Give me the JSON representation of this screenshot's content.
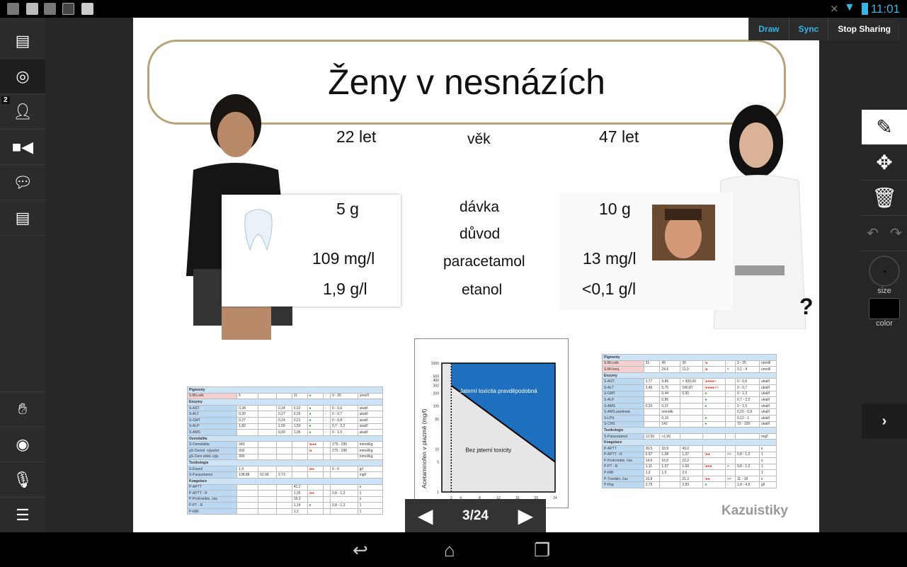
{
  "status_bar": {
    "time": "11:01",
    "icons": [
      "app-icon",
      "mail-icon",
      "image-icon",
      "gallery-icon",
      "store-icon",
      "bluetooth-off-icon",
      "wifi-icon",
      "battery-icon"
    ]
  },
  "top_buttons": {
    "draw": "Draw",
    "sync": "Sync",
    "stop_sharing": "Stop Sharing",
    "accent": "#34b5e5"
  },
  "left_sidebar": {
    "participants_badge": "2",
    "items": [
      "layout",
      "broadcast",
      "participants",
      "video",
      "chat",
      "notes",
      "raise-hand",
      "webcam",
      "microphone",
      "menu"
    ]
  },
  "right_toolbar": {
    "size_label": "size",
    "color_label": "color",
    "current_color": "#000000"
  },
  "slide": {
    "title": "Ženy v nesnázích",
    "left_age": "22 let",
    "age_label": "věk",
    "right_age": "47 let",
    "labels": [
      "dávka",
      "důvod",
      "paracetamol",
      "etanol"
    ],
    "left_values": [
      "5 g",
      "109 mg/l",
      "1,9 g/l"
    ],
    "right_values": [
      "10 g",
      "13 mg/l",
      "<0,1 g/l"
    ],
    "question": "?",
    "footer": "Kazuistiky",
    "left_table": [
      [
        "Pigmenty"
      ],
      [
        "S-Bil.celk",
        "5",
        "",
        "",
        "11",
        "●",
        "-",
        "3 - 25",
        "umol/l"
      ],
      [
        "Enzymy"
      ],
      [
        "S-AST",
        "0,38",
        "",
        "0,34",
        "0,32",
        "●",
        "-",
        "0 - 0,6",
        "ukat/l"
      ],
      [
        "S-ALT",
        "0,30",
        "",
        "0,27",
        "0,26",
        "●",
        "-",
        "0 - 0,7",
        "ukat/l"
      ],
      [
        "S-GMT",
        "0,27",
        "",
        "0,24",
        "0,21",
        "●",
        "-",
        "0 - 0,8",
        "ukat/l"
      ],
      [
        "S-ALP",
        "1,82",
        "",
        "1,56",
        "1,50",
        "●",
        "-",
        "0,7 - 2,2",
        "ukat/l"
      ],
      [
        "S-AMS",
        "",
        "",
        "0,99",
        "1,06",
        "●",
        "-",
        "0 - 1,5",
        "ukat/l"
      ],
      [
        "Osmolalita"
      ],
      [
        "S-Osmolalita",
        "343",
        "",
        "",
        "",
        "|●●●",
        "",
        "275 - 295",
        "mmol/kg"
      ],
      [
        "gS-Osmol. výpočet",
        "302",
        "",
        "",
        "",
        "|●",
        "",
        "275 - 295",
        "mmol/kg"
      ],
      [
        "gS-Osm.elekt.-výp.",
        "300",
        "",
        "",
        "",
        "",
        "",
        "",
        "mmol/kg"
      ],
      [
        "Toxikologie"
      ],
      [
        "S-Etanol",
        "1,9",
        "",
        "",
        "",
        "|●●",
        "",
        "0 - 0",
        "g/l"
      ],
      [
        "S-Paracetamol",
        "108,88",
        "52,68",
        "2,73",
        "",
        "",
        "",
        "",
        "mg/l"
      ],
      [
        "Koagulace"
      ],
      [
        "P-APTT",
        "",
        "",
        "",
        "41,2",
        "",
        "",
        "",
        "s"
      ],
      [
        "P-APTT - R",
        "",
        "",
        "",
        "1,35",
        "|●●",
        "",
        "0,8 - 1,2",
        "1"
      ],
      [
        "P-Protrombin. čas",
        "",
        "",
        "",
        "15,0",
        "",
        "",
        "",
        "s"
      ],
      [
        "P-PT - R",
        "",
        "",
        "",
        "1,14",
        "●",
        "",
        "0,8 - 1,2",
        "1"
      ],
      [
        "P-INR",
        "",
        "",
        "",
        "1,2",
        "",
        "",
        "",
        "1"
      ]
    ],
    "right_table": [
      [
        "Pigmenty"
      ],
      [
        "S-Bil.celk",
        "31",
        "49",
        "30",
        "|●",
        "-",
        "3 - 25",
        "umol/l"
      ],
      [
        "S-Bil.konj.",
        "",
        "24,6",
        "11,0",
        "|●",
        "<",
        "0,1 - 4",
        "umol/l"
      ],
      [
        "Enzymy"
      ],
      [
        "S-AST",
        "3,77",
        "9,86",
        "> 300,00",
        "|●●●●>",
        "",
        "0 - 0,6",
        "ukat/l"
      ],
      [
        "S-ALT",
        "2,46",
        "5,75",
        "180,87",
        "|●●●●>>",
        "",
        "0 - 0,7",
        "ukat/l"
      ],
      [
        "S-GMT",
        "",
        "0,44",
        "0,90",
        "●",
        "-",
        "0 - 1,3",
        "ukat/l"
      ],
      [
        "S-ALP",
        "",
        "0,85",
        "",
        "●",
        "",
        "0,7 - 2,2",
        "ukat/l"
      ],
      [
        "S-AMS",
        "0,33",
        "0,37",
        "",
        "●",
        "-",
        "0 - 1,5",
        "ukat/l"
      ],
      [
        "S-AMS pankreat.",
        "",
        "neindik.",
        "",
        "",
        "",
        "0,15 - 0,9",
        "ukat/l"
      ],
      [
        "S-LPS",
        "",
        "0,15",
        "",
        "●",
        "",
        "0,12 - 1",
        "ukat/l"
      ],
      [
        "S-CHS",
        "",
        "142",
        "",
        "●",
        "",
        "72 - 190",
        "ukat/l"
      ],
      [
        "Toxikologie"
      ],
      [
        "S-Paracetamol",
        "12,50",
        "<1,00",
        "",
        "",
        "",
        "",
        "mg/l"
      ],
      [
        "Koagulace"
      ],
      [
        "P-APTT",
        "30,5",
        "33,9",
        "43,0",
        "",
        "",
        "",
        "s"
      ],
      [
        "P-APTT - R",
        "0,97",
        "1,08",
        "1,37",
        "|●●",
        ">>",
        "0,8 - 1,2",
        "1"
      ],
      [
        "P-Protrombin. čas",
        "14,6",
        "16,0",
        "22,2",
        "",
        "",
        "",
        "s"
      ],
      [
        "P-PT - R",
        "1,11",
        "1,37",
        "1,69",
        "|●●●",
        ">",
        "0,8 - 1,2",
        "1"
      ],
      [
        "P-INR",
        "1,2",
        "1,5",
        "2,0",
        "",
        "",
        "",
        "1"
      ],
      [
        "P-Trombin. čas",
        "16,8",
        "",
        "21,2",
        "|●●",
        ">>",
        "11 - 18",
        "s"
      ],
      [
        "P-Fbg",
        "2,79",
        "",
        "2,83",
        "●",
        "-",
        "1,8 - 4,5",
        "g/l"
      ]
    ]
  },
  "chart_data": {
    "type": "area",
    "ylabel": "Acetaminofen v plazmě (mg/l)",
    "yscale": "log",
    "ylim": [
      1,
      1000
    ],
    "xlim": [
      0,
      24
    ],
    "x_ticks": [
      "2",
      "4",
      "8",
      "12",
      "16",
      "20",
      "24"
    ],
    "y_ticks": [
      "1",
      "5",
      "10",
      "50",
      "100",
      "200",
      "300",
      "400",
      "500",
      "1000"
    ],
    "threshold_line": {
      "x": [
        2,
        24
      ],
      "y": [
        300,
        5
      ]
    },
    "vertical_dashed_x": 2,
    "regions": [
      {
        "label": "Jaterní toxicita pravděpodobná",
        "color": "#1f6fbf"
      },
      {
        "label": "Bez jaterní toxicity",
        "color": "#e6e6e6"
      }
    ]
  },
  "pager": {
    "label": "3/24"
  }
}
